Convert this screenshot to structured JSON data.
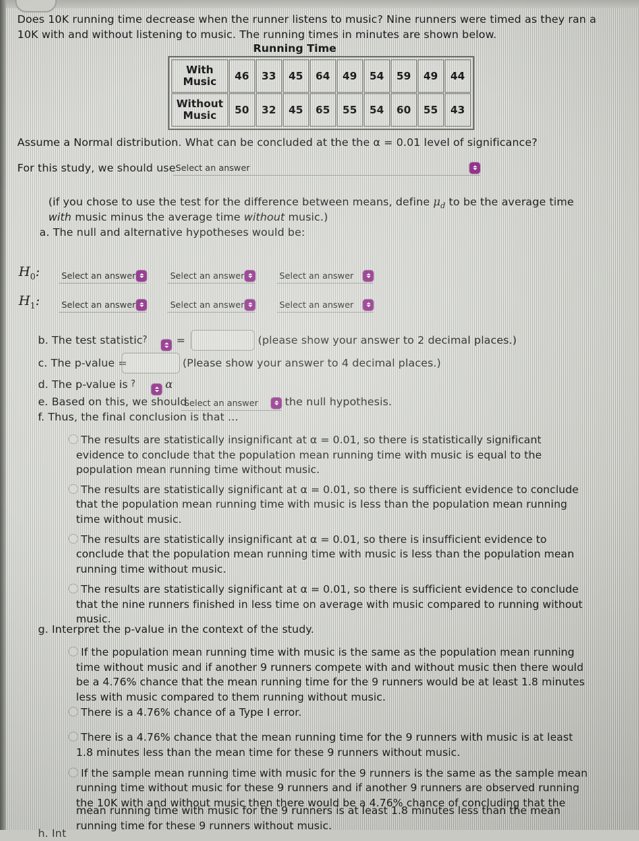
{
  "prompt": {
    "line1": "Does 10K running time decrease when the runner listens to music? Nine runners were timed as they ran a",
    "line2": "10K with and without listening to music. The running times in minutes are shown below."
  },
  "table": {
    "title": "Running Time",
    "rows": [
      {
        "label_line1": "With",
        "label_line2": "Music",
        "values": [
          "46",
          "33",
          "45",
          "64",
          "49",
          "54",
          "59",
          "49",
          "44"
        ]
      },
      {
        "label_line1": "Without",
        "label_line2": "Music",
        "values": [
          "50",
          "32",
          "45",
          "65",
          "55",
          "54",
          "60",
          "55",
          "43"
        ]
      }
    ]
  },
  "assume_line": "Assume a Normal distribution.  What can be concluded at the the α = 0.01 level of significance?",
  "study_use": {
    "label": "For this study, we should use",
    "select_placeholder": "Select an answer"
  },
  "note": {
    "line1_a": "(if you chose to use the test for the difference between means, define ",
    "line1_mu": "μ",
    "line1_sub": "d",
    "line1_b": " to be the average time",
    "line2_a": "with",
    "line2_b": " music minus the average time ",
    "line2_c": "without",
    "line2_d": " music.)",
    "part_a": "a. The null and alternative hypotheses would be:"
  },
  "hypotheses": {
    "h0_label": "H",
    "h0_sub": "0",
    "h1_label": "H",
    "h1_sub": "1",
    "colon": ":",
    "select_placeholder": "Select an answer"
  },
  "parts": {
    "b_label": "b. The test statistic",
    "b_qmark": "?",
    "b_equals": "=",
    "b_note": "(please show your answer to 2 decimal places.)",
    "c_label": "c. The p-value =",
    "c_note": "(Please show your answer to 4 decimal places.)",
    "d_label": "d. The p-value is",
    "d_qmark": "?",
    "d_alpha": "α",
    "e_label": "e. Based on this, we should",
    "e_select": "Select an answer",
    "e_tail": "the null hypothesis.",
    "f_label": "f. Thus, the final conclusion is that ...",
    "g_label": "g. Interpret the p-value in the context of the study.",
    "h_label": "h. Int"
  },
  "f_options": [
    [
      "The results are statistically insignificant at α = 0.01, so there is statistically significant",
      "evidence to conclude that the population mean running time with music is equal to the",
      "population mean running time without music."
    ],
    [
      "The results are statistically significant at α = 0.01, so there is sufficient evidence to conclude",
      "that the population mean running time with music is less than the population mean running",
      "time without music."
    ],
    [
      "The results are statistically insignificant at α = 0.01, so there is insufficient evidence to",
      "conclude that the population mean running time with music is less than the population mean",
      "running time without music."
    ],
    [
      "The results are statistically significant at α = 0.01, so there is sufficient evidence to conclude",
      "that the nine runners finished in less time on average with music compared to running without",
      "music."
    ]
  ],
  "g_options": [
    [
      "If the population mean running time with music is the same as the population mean running",
      "time without music and if another 9 runners compete with and without music then there would",
      "be a 4.76% chance that the mean running time for the 9 runners would be at least 1.8 minutes",
      "less with music compared to them running without music."
    ],
    [
      "There is a 4.76% chance of a Type I error."
    ],
    [
      "There is a 4.76% chance that the mean running time for the 9 runners with music is at least",
      "1.8 minutes less than the mean time for these 9 runners without music."
    ],
    [
      "If the sample mean running time with music for the 9 runners is the same as the sample mean",
      "running time without music for these 9 runners and if another 9 runners are observed running",
      "the 10K with and without music then there would be a 4.76% chance of concluding that the",
      "mean running time with music for the 9 runners is at least 1.8 minutes less than the mean",
      "running time for these 9 runners without music."
    ]
  ],
  "colors": {
    "accent_purple": "#8d2a86",
    "text": "#1b1b1b",
    "background": "#cfd0c9"
  }
}
